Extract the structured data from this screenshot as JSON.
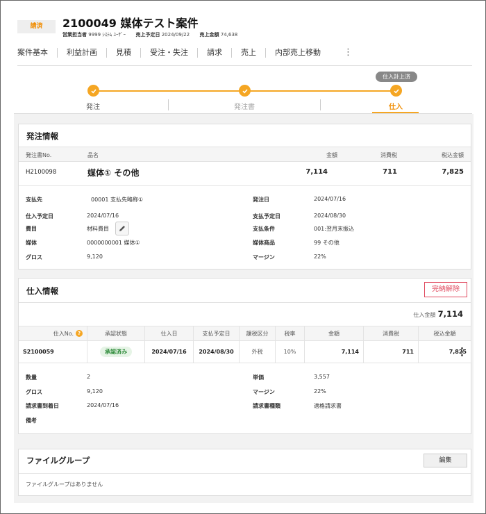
{
  "header": {
    "status": "請済",
    "title": "2100049 媒体テスト案件",
    "meta": {
      "sales_rep_label": "営業担当者",
      "sales_rep_value": "9999 ｼｽﾃﾑ ﾕｰｻﾞｰ",
      "sales_date_label": "売上予定日",
      "sales_date_value": "2024/09/22",
      "sales_amount_label": "売上金額",
      "sales_amount_value": "74,638"
    }
  },
  "tabs": [
    "案件基本",
    "利益計画",
    "見積",
    "受注・失注",
    "請求",
    "売上",
    "内部売上移動"
  ],
  "tab_more": "⋮",
  "stepper": {
    "badge": "仕入計上済",
    "steps": [
      "発注",
      "発注書",
      "仕入"
    ]
  },
  "order": {
    "title": "発注情報",
    "columns": [
      "発注書No.",
      "品名",
      "金額",
      "消費税",
      "税込金額"
    ],
    "row": {
      "no": "H2100098",
      "name": "媒体① その他",
      "amount": "7,114",
      "tax": "711",
      "total": "7,825"
    },
    "details_left": [
      {
        "label": "支払先",
        "value": "00001 支払先略称①"
      },
      {
        "label": "仕入予定日",
        "value": "2024/07/16"
      },
      {
        "label": "費目",
        "value": "材料費目"
      },
      {
        "label": "媒体",
        "value": "0000000001 媒体①"
      },
      {
        "label": "グロス",
        "value": "9,120"
      }
    ],
    "details_right": [
      {
        "label": "発注日",
        "value": "2024/07/16"
      },
      {
        "label": "支払予定日",
        "value": "2024/08/30"
      },
      {
        "label": "支払条件",
        "value": "001:翌月末振込"
      },
      {
        "label": "媒体商品",
        "value": "99 その他"
      },
      {
        "label": "マージン",
        "value": "22%"
      }
    ]
  },
  "purchase": {
    "title": "仕入情報",
    "cancel_label": "完納解除",
    "total_label": "仕入金額",
    "total_value": "7,114",
    "columns": [
      "仕入No.",
      "承認状態",
      "仕入日",
      "支払予定日",
      "課税区分",
      "税率",
      "金額",
      "消費税",
      "税込金額"
    ],
    "help_glyph": "?",
    "row": {
      "no": "S2100059",
      "status": "承認済み",
      "date": "2024/07/16",
      "pay_date": "2024/08/30",
      "tax_type": "外税",
      "rate": "10%",
      "amount": "7,114",
      "tax": "711",
      "total": "7,825"
    },
    "details_left": [
      {
        "label": "数量",
        "value": "2"
      },
      {
        "label": "グロス",
        "value": "9,120"
      },
      {
        "label": "請求書到着日",
        "value": "2024/07/16"
      },
      {
        "label": "備考",
        "value": ""
      }
    ],
    "details_right": [
      {
        "label": "単価",
        "value": "3,557"
      },
      {
        "label": "マージン",
        "value": "22%"
      },
      {
        "label": "請求書種類",
        "value": "適格請求書"
      }
    ]
  },
  "files": {
    "title": "ファイルグループ",
    "edit_label": "編集",
    "empty": "ファイルグループはありません"
  },
  "colors": {
    "accent": "#f5a623",
    "danger": "#e04a5f",
    "approved": "#2e8b3a"
  }
}
